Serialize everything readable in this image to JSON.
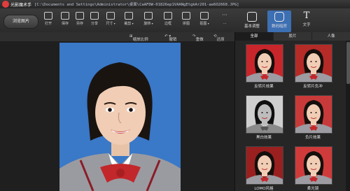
{
  "window": {
    "app_name": "光影魔术手",
    "path": "[C:\\Documents and Settings\\Administrator\\桌面\\CaAFDW-01826ep1VAANgEtgkAr201-ae6O2668.JPG]"
  },
  "toolbar": {
    "open_label": "浏览图片",
    "tools": [
      {
        "label": "打开",
        "icon": "folder-icon"
      },
      {
        "label": "保存",
        "icon": "save-icon"
      },
      {
        "label": "另存",
        "icon": "save-as-icon"
      },
      {
        "label": "分享",
        "icon": "share-icon"
      },
      {
        "label": "尺寸",
        "icon": "resize-icon",
        "dropdown": true
      },
      {
        "label": "裁剪",
        "icon": "crop-icon",
        "dropdown": true
      },
      {
        "label": "旋转",
        "icon": "rotate-icon",
        "dropdown": true
      },
      {
        "label": "边框",
        "icon": "frame-icon"
      },
      {
        "label": "拼图",
        "icon": "collage-icon"
      },
      {
        "label": "抠图",
        "icon": "cutout-icon",
        "dropdown": true
      },
      {
        "label": "...",
        "icon": "more-icon"
      }
    ],
    "right_tools": [
      {
        "label": "基本调整",
        "icon": "adjust-icon",
        "active": false
      },
      {
        "label": "数码暗房",
        "icon": "camera-icon",
        "active": true
      },
      {
        "label": "文字",
        "icon": "text-icon",
        "active": false
      }
    ]
  },
  "subbar": {
    "compare": "缩放比例",
    "undo": "撤销",
    "redo": "重做",
    "restore": "还原"
  },
  "side_panel": {
    "tabs": [
      "全部",
      "胶片",
      "人像"
    ],
    "effects": [
      {
        "label": "反转片效果",
        "tint": "#c8262b"
      },
      {
        "label": "反转片负冲",
        "tint": "#b52b28"
      },
      {
        "label": "黑白效果",
        "tint": "#d9d9d9"
      },
      {
        "label": "负片效果",
        "tint": "#c83a3a"
      },
      {
        "label": "LOMO风格",
        "tint": "#9a2020"
      },
      {
        "label": "柔光镜",
        "tint": "#cf3b3b"
      }
    ]
  },
  "photo": {
    "background_color": "#3a78c8"
  }
}
